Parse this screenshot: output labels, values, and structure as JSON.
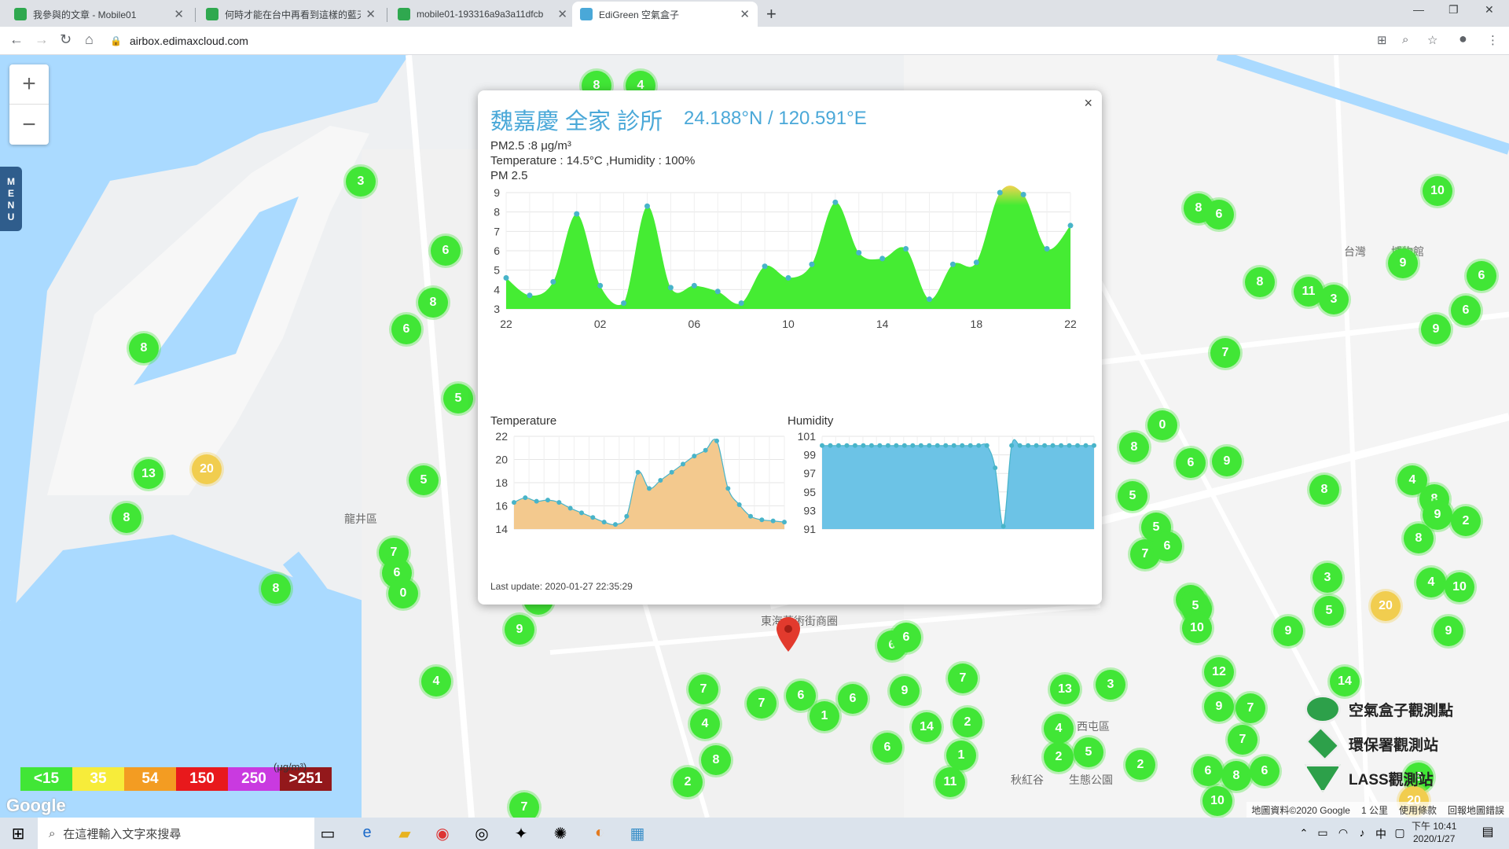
{
  "browser": {
    "tabs": [
      {
        "title": "我參與的文章 - Mobile01",
        "color": "#2fa84f"
      },
      {
        "title": "何時才能在台中再看到這樣的藍天",
        "color": "#2fa84f"
      },
      {
        "title": "mobile01-193316a9a3a11dfcb",
        "color": "#2fa84f"
      },
      {
        "title": "EdiGreen 空氣盒子",
        "color": "#4aa8d8",
        "active": true
      }
    ],
    "new_tab": "+",
    "url": "airbox.edimaxcloud.com"
  },
  "map": {
    "zoom_in": "+",
    "zoom_out": "−",
    "menu_label": "MENU",
    "place_labels": [
      "龍井區",
      "東海藝術街商圈",
      "秋紅谷",
      "生態公園",
      "台灣",
      "博物館",
      "西屯區"
    ],
    "markers": [
      "3",
      "8",
      "6",
      "6",
      "8",
      "5",
      "13",
      "20",
      "8",
      "5",
      "7",
      "6",
      "0",
      "8",
      "9",
      "4",
      "3",
      "8",
      "4",
      "7",
      "4",
      "8",
      "2",
      "7",
      "7",
      "6",
      "1",
      "6",
      "6",
      "6",
      "9",
      "7",
      "2",
      "14",
      "6",
      "1",
      "11",
      "13",
      "4",
      "2",
      "5",
      "3",
      "2",
      "0",
      "8",
      "6",
      "9",
      "5",
      "5",
      "7",
      "6",
      "8",
      "2",
      "3",
      "5",
      "8",
      "6",
      "10",
      "9",
      "8",
      "11",
      "3",
      "7",
      "9",
      "6",
      "6",
      "8",
      "4",
      "9",
      "2",
      "8",
      "4",
      "10",
      "5",
      "10",
      "5",
      "9",
      "20",
      "9",
      "12",
      "9",
      "7",
      "7",
      "6",
      "8",
      "6",
      "14",
      "10",
      "6",
      "20"
    ],
    "legend": [
      {
        "label": "<15",
        "color": "#41e636"
      },
      {
        "label": "35",
        "color": "#f7ec3a"
      },
      {
        "label": "54",
        "color": "#f39c22"
      },
      {
        "label": "150",
        "color": "#e8191c"
      },
      {
        "label": "250",
        "color": "#c93ae0"
      },
      {
        "label": ">251",
        "color": "#93181b"
      }
    ],
    "legend_unit": "(μg/m³)",
    "google": "Google",
    "attribution": {
      "data": "地圖資料©2020 Google",
      "scale": "1 公里",
      "terms": "使用條款",
      "report": "回報地圖錯誤"
    },
    "station_legend": [
      {
        "label": "空氣盒子觀測點"
      },
      {
        "label": "環保署觀測站"
      },
      {
        "label": "LASS觀測站"
      }
    ]
  },
  "popup": {
    "title": "魏嘉慶 全家 診所",
    "coords": "24.188°N / 120.591°E",
    "pm25_line": "PM2.5 :8 μg/m³",
    "temp_line": "Temperature : 14.5°C ,Humidity : 100%",
    "chart_title": "PM 2.5",
    "temp_title": "Temperature",
    "hum_title": "Humidity",
    "last_update": "Last update: 2020-01-27 22:35:29",
    "close": "×"
  },
  "chart_data": [
    {
      "type": "area",
      "title": "PM 2.5",
      "x": [
        22,
        23,
        24,
        25,
        26,
        27,
        28,
        29,
        30,
        31,
        32,
        33,
        34,
        35,
        36,
        37,
        38,
        39,
        40,
        41,
        42,
        43,
        44,
        45,
        46
      ],
      "x_tick_labels": [
        "22",
        "02",
        "06",
        "10",
        "14",
        "18",
        "22"
      ],
      "y_ticks": [
        3,
        4,
        5,
        6,
        7,
        8,
        9
      ],
      "ylim": [
        3,
        9
      ],
      "xlim": [
        22,
        46
      ],
      "series": [
        {
          "values": [
            4.6,
            3.7,
            4.4,
            7.9,
            4.2,
            3.3,
            8.3,
            4.1,
            4.2,
            3.9,
            3.3,
            5.2,
            4.6,
            5.3,
            8.5,
            5.9,
            5.6,
            6.1,
            3.5,
            5.3,
            5.4,
            9.0,
            8.9,
            6.1,
            7.3
          ]
        }
      ],
      "colors": {
        "fill_low": "#45ec33",
        "fill_high": "#f2d34f"
      }
    },
    {
      "type": "area",
      "title": "Temperature",
      "x": [
        0,
        1,
        2,
        3,
        4,
        5,
        6,
        7,
        8,
        9,
        10,
        11,
        12,
        13,
        14,
        15,
        16,
        17,
        18,
        19,
        20,
        21,
        22,
        23,
        24
      ],
      "y_ticks": [
        14,
        16,
        18,
        20,
        22
      ],
      "ylim": [
        14,
        22
      ],
      "series": [
        {
          "values": [
            16.3,
            16.7,
            16.4,
            16.5,
            16.3,
            15.8,
            15.4,
            15.0,
            14.6,
            14.4,
            15.1,
            18.9,
            17.5,
            18.2,
            18.9,
            19.6,
            20.3,
            20.8,
            21.6,
            17.5,
            16.1,
            15.1,
            14.8,
            14.7,
            14.6
          ]
        }
      ],
      "colors": {
        "fill": "#f3c98e",
        "line": "#48b4c9"
      }
    },
    {
      "type": "area",
      "title": "Humidity",
      "x": [
        0,
        1,
        2,
        3,
        4,
        5,
        6,
        7,
        8,
        9,
        10,
        11,
        12,
        13,
        14,
        15,
        16,
        17,
        18,
        19,
        20,
        21,
        22,
        23,
        24,
        25,
        26,
        27,
        28,
        29,
        30,
        31,
        32,
        33
      ],
      "y_ticks": [
        91,
        93,
        95,
        97,
        99,
        101
      ],
      "ylim": [
        91,
        101
      ],
      "series": [
        {
          "values": [
            100,
            100,
            100,
            100,
            100,
            100,
            100,
            100,
            100,
            100,
            100,
            100,
            100,
            100,
            100,
            100,
            100,
            100,
            100,
            100,
            100,
            97.6,
            91.3,
            100,
            100,
            100,
            100,
            100,
            100,
            100,
            100,
            100,
            100,
            100
          ]
        }
      ],
      "colors": {
        "fill": "#6cc3e6",
        "line": "#48b4c9"
      }
    }
  ],
  "taskbar": {
    "search_placeholder": "在這裡輸入文字來搜尋",
    "time": "下午 10:41",
    "date": "2020/1/27",
    "ime": "中"
  }
}
